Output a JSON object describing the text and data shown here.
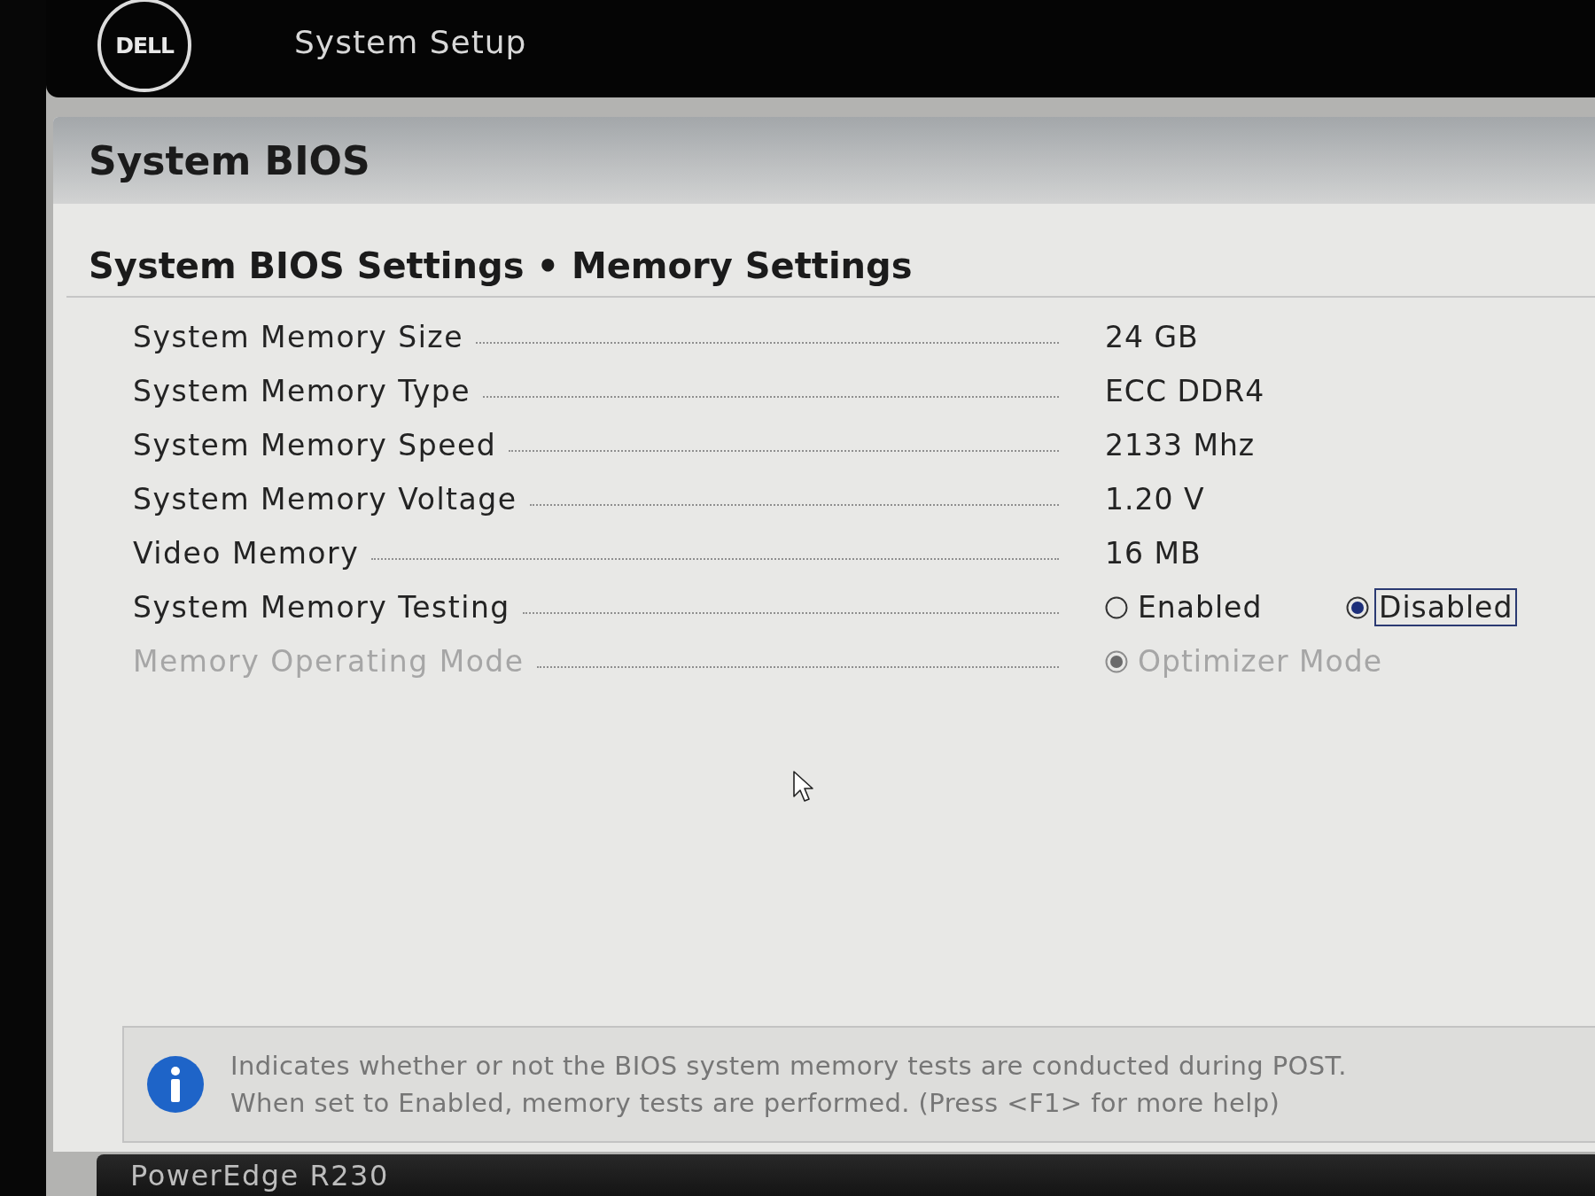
{
  "header": {
    "logo": "DELL",
    "title": "System Setup"
  },
  "panel": {
    "title": "System BIOS"
  },
  "page": {
    "title": "System BIOS Settings • Memory Settings"
  },
  "settings": [
    {
      "label": "System Memory Size",
      "kind": "value",
      "value": "24 GB",
      "disabled": false
    },
    {
      "label": "System Memory Type",
      "kind": "value",
      "value": "ECC DDR4",
      "disabled": false
    },
    {
      "label": "System Memory Speed",
      "kind": "value",
      "value": "2133 Mhz",
      "disabled": false
    },
    {
      "label": "System Memory Voltage",
      "kind": "value",
      "value": "1.20 V",
      "disabled": false
    },
    {
      "label": "Video Memory",
      "kind": "value",
      "value": "16 MB",
      "disabled": false
    },
    {
      "label": "System Memory Testing",
      "kind": "radio",
      "disabled": false,
      "options": [
        {
          "label": "Enabled",
          "selected": false,
          "focused": false
        },
        {
          "label": "Disabled",
          "selected": true,
          "focused": true
        }
      ]
    },
    {
      "label": "Memory Operating Mode",
      "kind": "radio",
      "disabled": true,
      "options": [
        {
          "label": "Optimizer Mode",
          "selected": true,
          "focused": false
        }
      ]
    }
  ],
  "help": {
    "lines": [
      "Indicates whether or not the BIOS system memory tests are conducted during POST.",
      "When set to Enabled, memory tests are performed. (Press <F1> for more help)"
    ]
  },
  "footer": {
    "model": "PowerEdge R230"
  }
}
